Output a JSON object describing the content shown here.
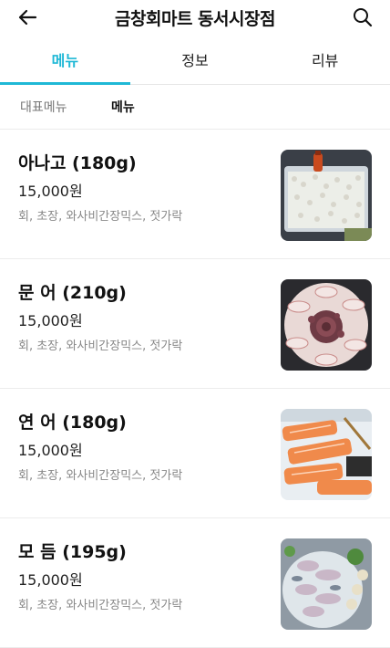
{
  "header": {
    "title": "금창회마트 동서시장점",
    "back_icon": "back-arrow-icon",
    "search_icon": "search-icon"
  },
  "tabs": [
    {
      "label": "메뉴",
      "active": true
    },
    {
      "label": "정보",
      "active": false
    },
    {
      "label": "리뷰",
      "active": false
    }
  ],
  "subtabs": [
    {
      "label": "대표메뉴",
      "active": false
    },
    {
      "label": "메뉴",
      "active": true
    }
  ],
  "colors": {
    "accent": "#1fb8d6",
    "desc_text": "#888888"
  },
  "menu_items": [
    {
      "name": "아나고 (180g)",
      "price": "15,000원",
      "desc": "회, 초장, 와사비간장믹스, 젓가락",
      "image": "anago-sashimi-photo"
    },
    {
      "name": "문 어 (210g)",
      "price": "15,000원",
      "desc": "회, 초장, 와사비간장믹스, 젓가락",
      "image": "octopus-sashimi-photo"
    },
    {
      "name": "연 어 (180g)",
      "price": "15,000원",
      "desc": "회, 초장, 와사비간장믹스, 젓가락",
      "image": "salmon-sashimi-photo"
    },
    {
      "name": "모 듬 (195g)",
      "price": "15,000원",
      "desc": "회, 초장, 와사비간장믹스, 젓가락",
      "image": "assorted-sashimi-photo"
    }
  ]
}
